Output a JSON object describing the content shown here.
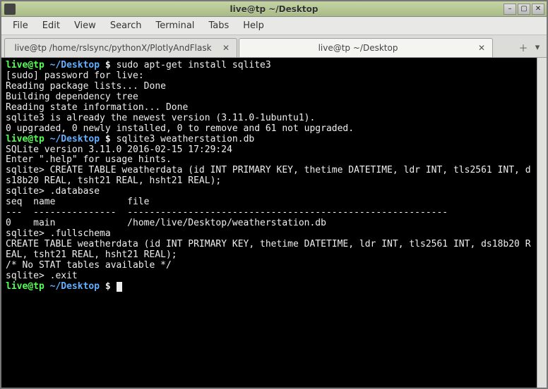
{
  "window": {
    "title": "live@tp ~/Desktop"
  },
  "menu": {
    "file": "File",
    "edit": "Edit",
    "view": "View",
    "search": "Search",
    "terminal": "Terminal",
    "tabs": "Tabs",
    "help": "Help"
  },
  "tabs": [
    {
      "label": "live@tp /home/rslsync/pythonX/PlotlyAndFlask",
      "active": false
    },
    {
      "label": "live@tp ~/Desktop",
      "active": true
    }
  ],
  "prompt": {
    "user_host": "live@tp",
    "sep": " ",
    "path": "~/Desktop",
    "dollar": " $ "
  },
  "session": {
    "cmd1": "sudo apt-get install sqlite3",
    "out1": "[sudo] password for live:\nReading package lists... Done\nBuilding dependency tree\nReading state information... Done\nsqlite3 is already the newest version (3.11.0-1ubuntu1).\n0 upgraded, 0 newly installed, 0 to remove and 61 not upgraded.",
    "cmd2": "sqlite3 weatherstation.db",
    "out2": "SQLite version 3.11.0 2016-02-15 17:29:24\nEnter \".help\" for usage hints.\nsqlite> CREATE TABLE weatherdata (id INT PRIMARY KEY, thetime DATETIME, ldr INT, tls2561 INT, ds18b20 REAL, tsht21 REAL, hsht21 REAL);\nsqlite> .database\nseq  name             file\n---  ---------------  ----------------------------------------------------------\n0    main             /home/live/Desktop/weatherstation.db\nsqlite> .fullschema\nCREATE TABLE weatherdata (id INT PRIMARY KEY, thetime DATETIME, ldr INT, tls2561 INT, ds18b20 REAL, tsht21 REAL, hsht21 REAL);\n/* No STAT tables available */\nsqlite> .exit"
  }
}
